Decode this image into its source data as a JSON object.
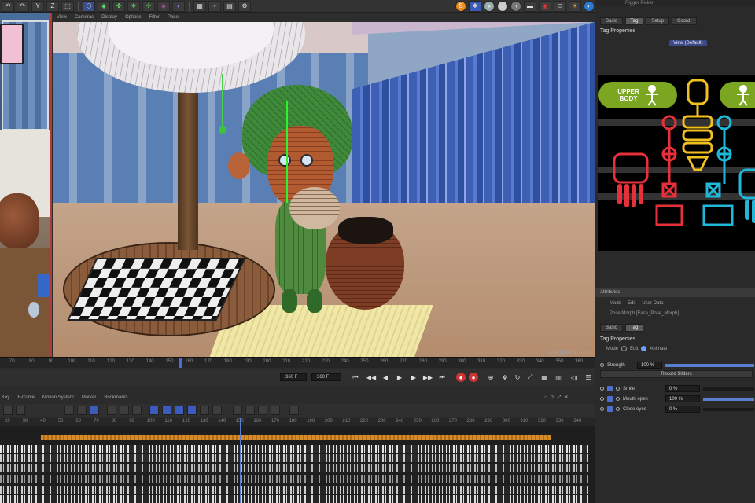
{
  "toolbar": {
    "undo": "↶",
    "redo": "↷",
    "axis_y": "Y",
    "axis_z": "Z",
    "sel": "⬚",
    "icons": [
      "move-icon",
      "scale-icon",
      "cube-icon",
      "spline-icon",
      "generator-icon",
      "deformer-icon",
      "field-icon",
      "light-icon",
      "scene-icon",
      "camera-icon",
      "render-icon",
      "render-settings-icon"
    ]
  },
  "viewport_menu": {
    "items": [
      "View",
      "Cameras",
      "Display",
      "Options",
      "Filter",
      "Panel"
    ]
  },
  "viewport": {
    "footer": "Grid Spacing: 10 cm"
  },
  "right_panel": {
    "title": "Rigger Picker",
    "tabs": [
      "Basic",
      "Tag",
      "Setup",
      "Coord."
    ],
    "active_tab": "Tag",
    "heading": "Tag Properties",
    "view_button": "View (Default)",
    "picker": {
      "upper_body": "UPPER BODY",
      "colors": {
        "accent_green": "#7aa622",
        "red": "#e8303a",
        "yellow": "#f0c020",
        "cyan": "#20b8d8"
      }
    }
  },
  "attributes": {
    "title": "Attributes",
    "menu": [
      "Mode",
      "Edit",
      "User Data"
    ],
    "object": "Pose Morph [Face_Pose_Morph]",
    "tabs": [
      "Basic",
      "Tag"
    ],
    "heading": "Tag Properties",
    "mode_label": "Mode",
    "mode_edit": "Edit",
    "mode_animate": "Animate",
    "strength_label": "Strength",
    "strength_value": "100 %",
    "strength_level": 1.0,
    "record_button": "Record Sliders",
    "morphs": [
      {
        "label": "Smile",
        "value": "0 %",
        "level": 0.0
      },
      {
        "label": "Mouth open",
        "value": "100 %",
        "level": 1.0
      },
      {
        "label": "Close eyes",
        "value": "0 %",
        "level": 0.0
      }
    ]
  },
  "timeline": {
    "ruler_ticks": [
      "70",
      "80",
      "90",
      "100",
      "110",
      "120",
      "130",
      "140",
      "150",
      "160",
      "170",
      "180",
      "190",
      "200",
      "210",
      "220",
      "230",
      "240",
      "250",
      "260",
      "270",
      "280",
      "290",
      "300",
      "310",
      "320",
      "330",
      "340",
      "350",
      "360"
    ],
    "current_frame": "148",
    "end_field": "360 F",
    "end_field2": "360 F",
    "menu": [
      "Key",
      "F-Curve",
      "Motion System",
      "Marker",
      "Bookmarks"
    ],
    "ruler2_ticks": [
      "20",
      "30",
      "40",
      "50",
      "60",
      "70",
      "80",
      "90",
      "100",
      "110",
      "120",
      "130",
      "140",
      "150",
      "160",
      "170",
      "180",
      "190",
      "200",
      "210",
      "220",
      "230",
      "240",
      "250",
      "260",
      "270",
      "280",
      "290",
      "300",
      "310",
      "320",
      "330",
      "340"
    ]
  }
}
